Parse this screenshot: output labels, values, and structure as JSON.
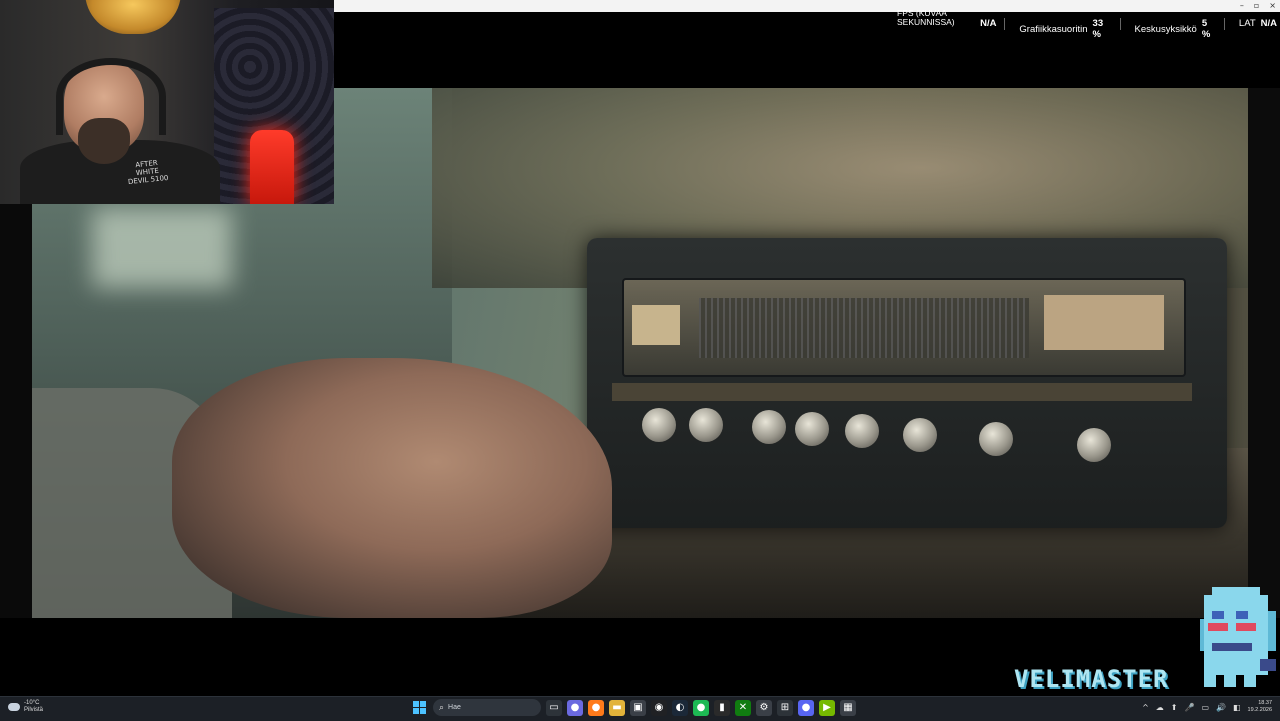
{
  "perf_overlay": {
    "fps_label": "FPS (KUVAA SEKUNNISSA)",
    "fps_value": "N/A",
    "gpu_label": "Grafiikkasuoritin",
    "gpu_value": "33 %",
    "cpu_label": "Keskusyksikkö",
    "cpu_value": "5 %",
    "lat_label": "LAT",
    "lat_value": "N/A"
  },
  "window": {
    "controls": [
      "–",
      "▫",
      "×"
    ]
  },
  "webcam": {
    "shirt_text": "AFTER\nWHITE\nDEVIL 5100"
  },
  "logo": {
    "text": "VELIMASTER"
  },
  "taskbar": {
    "weather_temp": "-10°C",
    "weather_desc": "Pilvistä",
    "search_placeholder": "Hae",
    "clock_time": "18.37",
    "clock_date": "19.2.2026",
    "apps": [
      {
        "name": "file-explorer-app-icon",
        "glyph": "▭",
        "color": "#2d3339"
      },
      {
        "name": "teams-app-icon",
        "glyph": "●",
        "color": "#6b6ae0"
      },
      {
        "name": "firefox-app-icon",
        "glyph": "●",
        "color": "#ff7a1a"
      },
      {
        "name": "folder-app-icon",
        "glyph": "▬",
        "color": "#e2b33a"
      },
      {
        "name": "store-app-icon",
        "glyph": "▣",
        "color": "#3a3f47"
      },
      {
        "name": "obs-app-icon",
        "glyph": "◉",
        "color": "#202124"
      },
      {
        "name": "steam-app-icon",
        "glyph": "◐",
        "color": "#1b2838"
      },
      {
        "name": "spotify-app-icon",
        "glyph": "●",
        "color": "#1db954"
      },
      {
        "name": "epic-app-icon",
        "glyph": "▮",
        "color": "#2a2a2a"
      },
      {
        "name": "xbox-app-icon",
        "glyph": "✕",
        "color": "#107c10"
      },
      {
        "name": "settings-app-icon",
        "glyph": "⚙",
        "color": "#3a3f47"
      },
      {
        "name": "network-app-icon",
        "glyph": "⊞",
        "color": "#2d3339"
      },
      {
        "name": "discord-app-icon",
        "glyph": "●",
        "color": "#5865f2"
      },
      {
        "name": "nvidia-app-icon",
        "glyph": "▶",
        "color": "#76b900"
      },
      {
        "name": "monitor-app-icon",
        "glyph": "▦",
        "color": "#3a3f47"
      }
    ],
    "tray_icons": [
      "^",
      "☁",
      "⬆",
      "🎤",
      "▭",
      "🔊",
      "◧"
    ]
  },
  "colors": {
    "logo_cyan": "#aee6f2",
    "logo_shadow": "#3ea1c1",
    "taskbar_bg": "#1c2026",
    "accent_blue": "#4cc2ff",
    "webcam_red_light": "#ff3b2a"
  }
}
